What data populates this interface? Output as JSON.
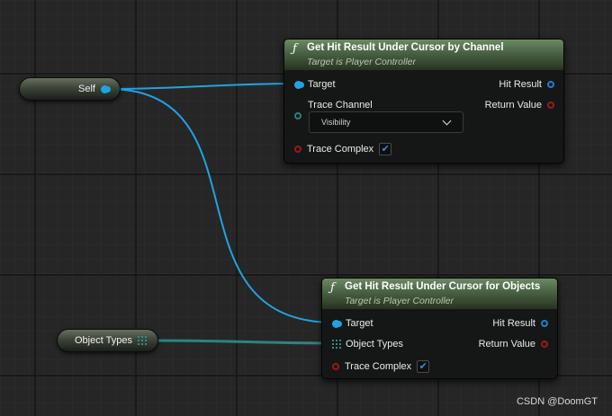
{
  "self_node": {
    "label": "Self"
  },
  "object_types_node": {
    "label": "Object Types"
  },
  "node_channel": {
    "title": "Get Hit Result Under Cursor by Channel",
    "subtitle": "Target is Player Controller",
    "inputs": {
      "target": "Target",
      "trace_channel": "Trace Channel",
      "trace_complex": "Trace Complex"
    },
    "outputs": {
      "hit_result": "Hit Result",
      "return_value": "Return Value"
    },
    "trace_channel_value": "Visibility",
    "trace_complex_checked": true
  },
  "node_objects": {
    "title": "Get Hit Result Under Cursor for Objects",
    "subtitle": "Target is Player Controller",
    "inputs": {
      "target": "Target",
      "object_types": "Object Types",
      "trace_complex": "Trace Complex"
    },
    "outputs": {
      "hit_result": "Hit Result",
      "return_value": "Return Value"
    },
    "trace_complex_checked": true
  },
  "checkmark_glyph": "✔",
  "function_glyph": "ƒ",
  "watermark": "CSDN @DoomGT",
  "colors": {
    "exec_wire": "#1fa3e3",
    "object_wire": "#2a857d",
    "node_header": "#4c6546",
    "bool_pin": "#a01717",
    "struct_pin": "#1f7fcf"
  }
}
